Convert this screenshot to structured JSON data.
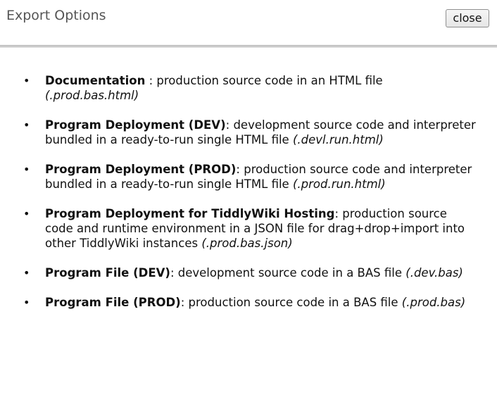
{
  "dialog": {
    "title": "Export Options",
    "close_label": "close"
  },
  "options": [
    {
      "name": "Documentation",
      "sep": " : ",
      "description": "production source code in an HTML file ",
      "extension": "(.prod.bas.html)"
    },
    {
      "name": "Program Deployment (DEV)",
      "sep": ": ",
      "description": "development source code and interpreter bundled in a ready-to-run single HTML file ",
      "extension": "(.devl.run.html)"
    },
    {
      "name": "Program Deployment (PROD)",
      "sep": ": ",
      "description": "production source code and interpreter bundled in a ready-to-run single HTML file ",
      "extension": "(.prod.run.html)"
    },
    {
      "name": "Program Deployment for TiddlyWiki Hosting",
      "sep": ": ",
      "description": "production source code and runtime environment in a JSON file for drag+drop+import into other TiddlyWiki instances ",
      "extension": "(.prod.bas.json)"
    },
    {
      "name": "Program File (DEV)",
      "sep": ": ",
      "description": "development source code in a BAS file ",
      "extension": "(.dev.bas)"
    },
    {
      "name": "Program File (PROD)",
      "sep": ": ",
      "description": "production source code in a BAS file ",
      "extension": "(.prod.bas)"
    }
  ]
}
